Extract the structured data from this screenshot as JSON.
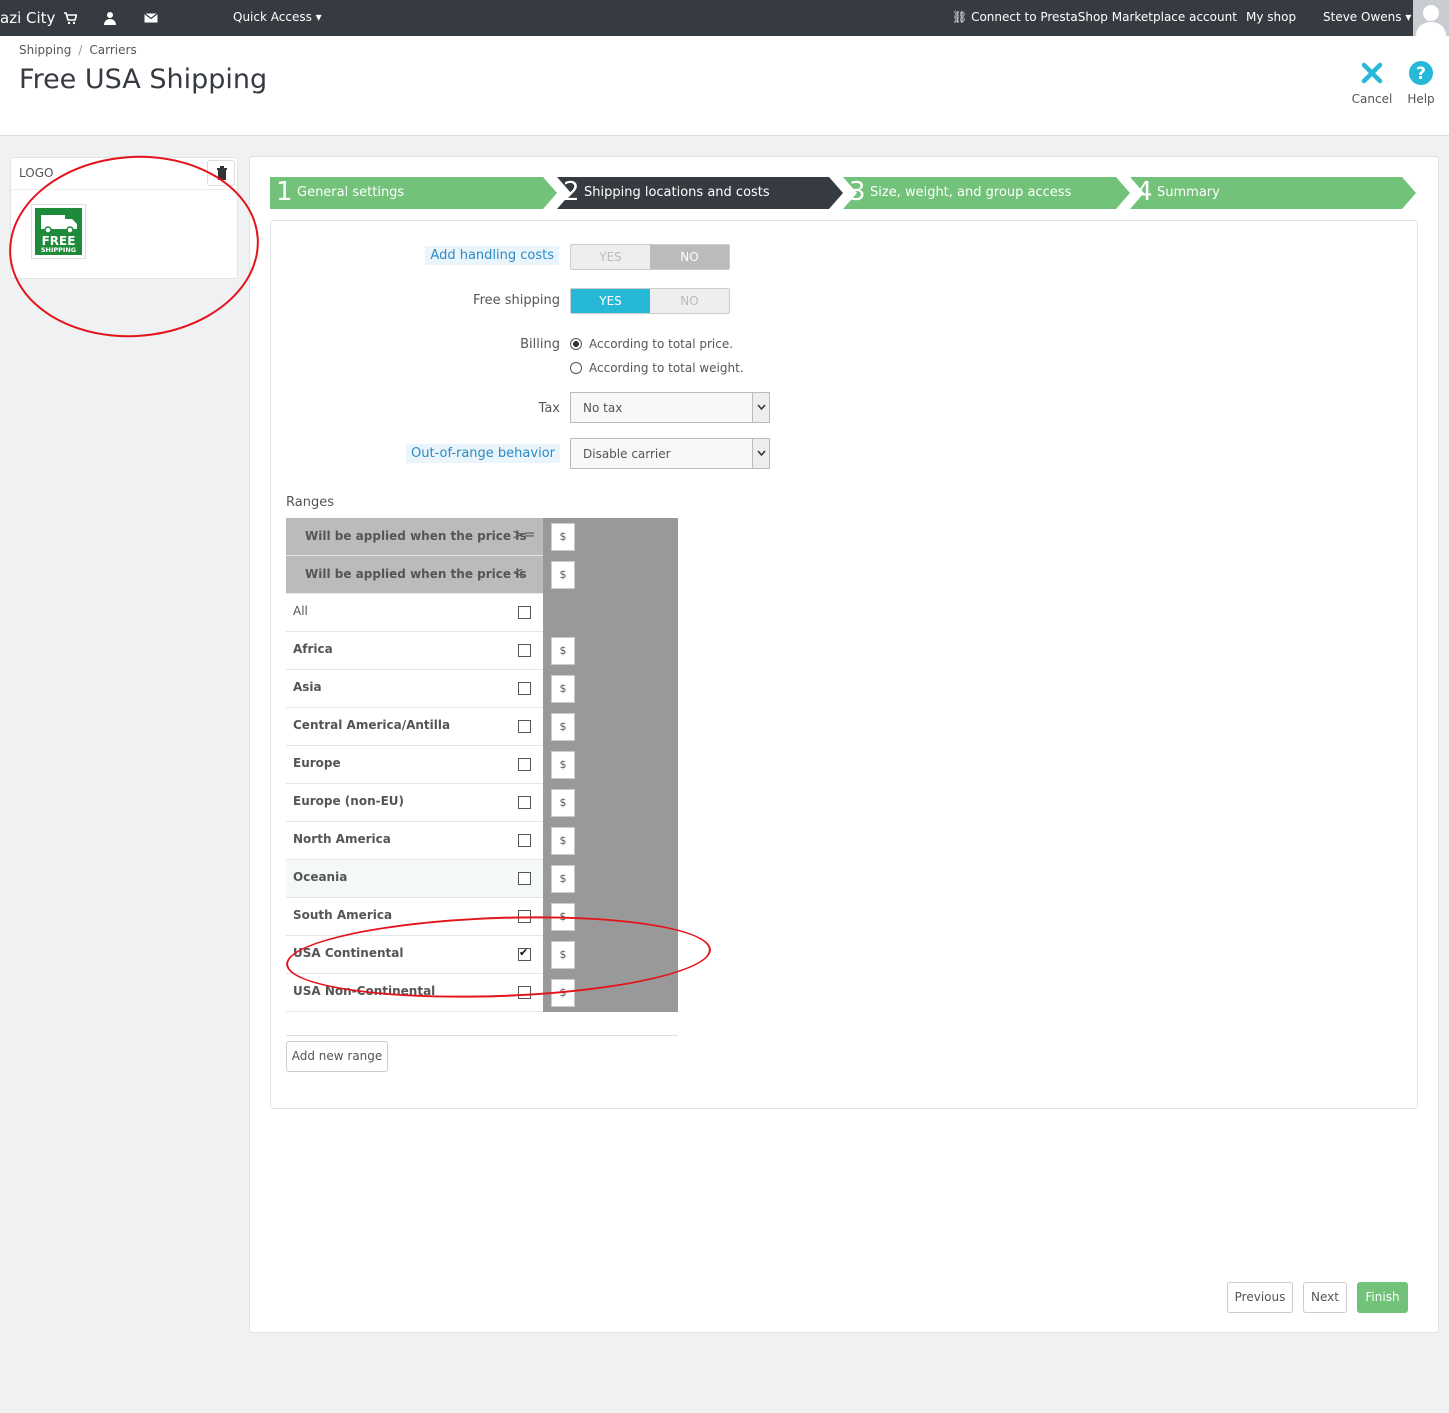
{
  "topbar": {
    "brand": "azi City",
    "quick_access": "Quick Access",
    "connect": "Connect to PrestaShop Marketplace account",
    "my_shop": "My shop",
    "user": "Steve Owens"
  },
  "breadcrumb": {
    "item1": "Shipping",
    "separator": "/",
    "item2": "Carriers"
  },
  "page_title": "Free USA Shipping",
  "toolbar": {
    "cancel": "Cancel",
    "help": "Help"
  },
  "logo_panel": {
    "title": "LOGO",
    "image_text_line1": "FREE",
    "image_text_line2": "SHIPPING"
  },
  "steps": [
    {
      "num": "1",
      "label": "General settings"
    },
    {
      "num": "2",
      "label": "Shipping locations and costs"
    },
    {
      "num": "3",
      "label": "Size, weight, and group access"
    },
    {
      "num": "4",
      "label": "Summary"
    }
  ],
  "form": {
    "handling_label": "Add handling costs",
    "free_shipping_label": "Free shipping",
    "yes": "YES",
    "no": "NO",
    "billing_label": "Billing",
    "billing_opt1": "According to total price.",
    "billing_opt2": "According to total weight.",
    "tax_label": "Tax",
    "tax_value": "No tax",
    "oor_label": "Out-of-range behavior",
    "oor_value": "Disable carrier"
  },
  "ranges": {
    "title": "Ranges",
    "row_ge": "Will be applied when the price is",
    "op_ge": ">=",
    "row_lt": "Will be applied when the price is",
    "op_lt": "<",
    "currency": "$",
    "all_label": "All",
    "zones": [
      {
        "name": "Africa",
        "checked": false
      },
      {
        "name": "Asia",
        "checked": false
      },
      {
        "name": "Central America/Antilla",
        "checked": false
      },
      {
        "name": "Europe",
        "checked": false
      },
      {
        "name": "Europe (non-EU)",
        "checked": false
      },
      {
        "name": "North America",
        "checked": false
      },
      {
        "name": "Oceania",
        "checked": false
      },
      {
        "name": "South America",
        "checked": false
      },
      {
        "name": "USA Continental",
        "checked": true
      },
      {
        "name": "USA Non-Continental",
        "checked": false
      }
    ],
    "add_range": "Add new range"
  },
  "footer": {
    "previous": "Previous",
    "next": "Next",
    "finish": "Finish"
  },
  "colors": {
    "step_active": "#363a41",
    "step_done": "#72c279",
    "accent": "#25b9d7",
    "annotation": "#e3141b"
  }
}
